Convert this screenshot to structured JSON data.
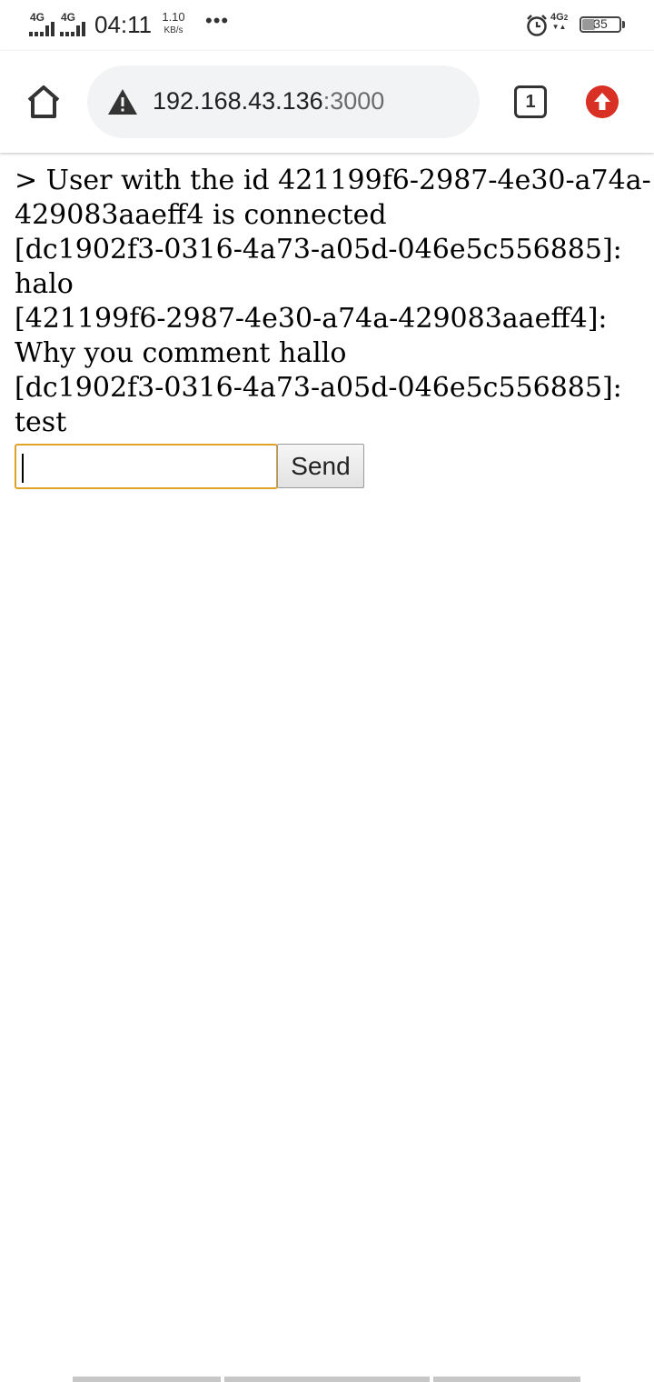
{
  "status_bar": {
    "sim1_network": "4G",
    "sim2_network": "4G",
    "time": "04:11",
    "speed_value": "1.10",
    "speed_unit": "KB/s",
    "more_indicator": "•••",
    "right_network": "4G",
    "right_network_sub": "2",
    "battery_level": "35",
    "icons": [
      "signal-icon",
      "alarm-icon",
      "battery-icon"
    ]
  },
  "browser": {
    "url_host": "192.168.43.136",
    "url_port": ":3000",
    "tab_count": "1",
    "icons": [
      "home-icon",
      "not-secure-warning-icon",
      "tabs-icon",
      "update-arrow-icon"
    ],
    "colors": {
      "update_badge": "#d93025",
      "omnibox_bg": "#f1f3f4"
    }
  },
  "page": {
    "lines": [
      "> User with the id 421199f6-2987-4e30-a74a-",
      "429083aaeff4 is connected",
      "[dc1902f3-0316-4a73-a05d-046e5c556885]:",
      "halo",
      "[421199f6-2987-4e30-a74a-429083aaeff4]:",
      "Why you comment hallo",
      "[dc1902f3-0316-4a73-a05d-046e5c556885]:",
      "test"
    ],
    "input_value": "",
    "send_label": "Send",
    "colors": {
      "input_focus_border": "#e0a226"
    }
  }
}
